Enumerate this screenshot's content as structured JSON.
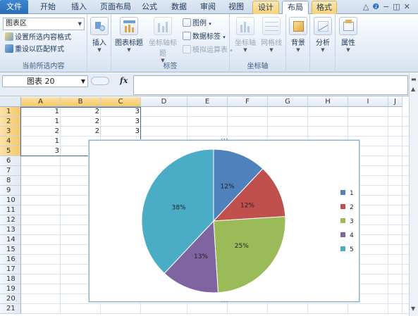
{
  "ribbon_tabs": [
    "文件",
    "开始",
    "插入",
    "页面布局",
    "公式",
    "数据",
    "审阅",
    "视图",
    "设计",
    "布局",
    "格式"
  ],
  "ribbon": {
    "current_selection": {
      "dropdown_value": "图表区",
      "format_selection": "设置所选内容格式",
      "reset_style": "重设以匹配样式",
      "label": "当前所选内容"
    },
    "insert": {
      "label": "插入"
    },
    "labels_group": {
      "chart_title": "图表标题",
      "axis_title": "坐标轴标题",
      "legend": "图例",
      "data_labels": "数据标签",
      "data_table": "模拟运算表",
      "label": "标签"
    },
    "axes_group": {
      "axes": "坐标轴",
      "gridlines": "网格线",
      "label": "坐标轴"
    },
    "background": {
      "label": "背景"
    },
    "analysis": {
      "label": "分析"
    },
    "properties": {
      "label": "属性"
    }
  },
  "formula_bar": {
    "name_box": "图表 20",
    "fx": "fx",
    "formula": ""
  },
  "sheet": {
    "columns": [
      "A",
      "B",
      "C",
      "D",
      "E",
      "F",
      "G",
      "H",
      "I",
      "J"
    ],
    "rows": [
      "1",
      "2",
      "3",
      "4",
      "5",
      "6",
      "7",
      "8",
      "9",
      "10",
      "11",
      "12",
      "13",
      "14",
      "15",
      "16",
      "17",
      "18",
      "19",
      "20",
      "21"
    ],
    "cells": [
      [
        "1",
        "2",
        "3"
      ],
      [
        "1",
        "2",
        "3"
      ],
      [
        "2",
        "2",
        "3"
      ],
      [
        "1",
        "",
        ""
      ],
      [
        "3",
        "",
        ""
      ]
    ]
  },
  "chart_data": {
    "type": "pie",
    "categories": [
      "1",
      "2",
      "3",
      "4",
      "5"
    ],
    "values": [
      12,
      12,
      25,
      13,
      38
    ],
    "data_labels": [
      "12%",
      "12%",
      "25%",
      "13%",
      "38%"
    ],
    "colors": [
      "#4f81bd",
      "#c0504d",
      "#9bbb59",
      "#8064a2",
      "#4bacc6"
    ],
    "legend_position": "right",
    "title": ""
  }
}
